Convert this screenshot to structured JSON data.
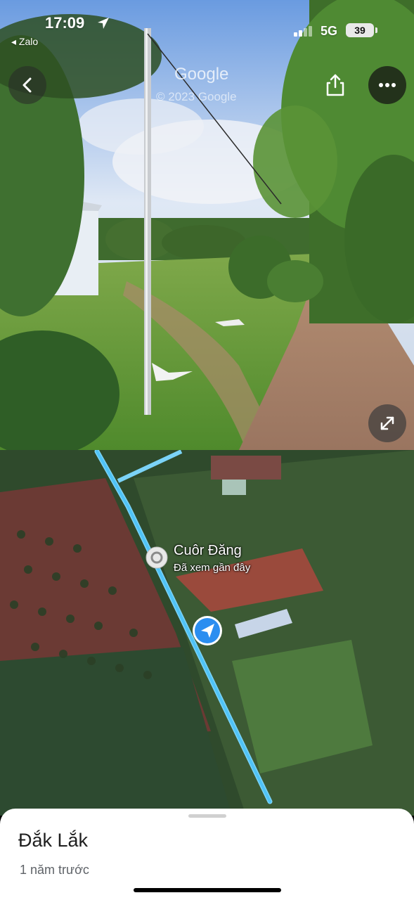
{
  "status_bar": {
    "time": "17:09",
    "back_app": "◂ Zalo",
    "network": "5G",
    "battery": "39"
  },
  "street_view": {
    "watermark": "Google",
    "copyright": "© 2023 Google",
    "icons": {
      "back": "chevron-left-icon",
      "share": "share-icon",
      "more": "more-horizontal-icon",
      "expand": "expand-icon"
    }
  },
  "map": {
    "place_name": "Cuôr Đăng",
    "place_subtitle": "Đã xem gần đây",
    "route_color": "#4fc3f7",
    "marker_color": "#2b8ef0"
  },
  "sheet": {
    "title": "Đắk Lắk",
    "subtitle": "1 năm trước"
  }
}
